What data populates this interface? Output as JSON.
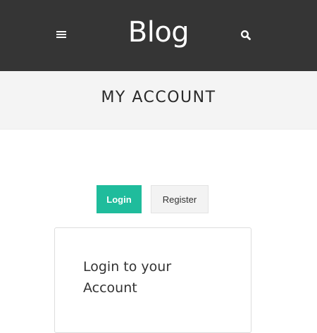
{
  "header": {
    "site_title": "Blog",
    "menu_icon": "hamburger-menu-icon",
    "search_icon": "search-icon",
    "background_color": "#353535"
  },
  "banner": {
    "page_title": "MY ACCOUNT",
    "background_color": "#f4f4f4"
  },
  "account_tabs": {
    "login_label": "Login",
    "register_label": "Register",
    "active_color": "#1fbc9c"
  },
  "login_card": {
    "title": "Login to your Account"
  }
}
